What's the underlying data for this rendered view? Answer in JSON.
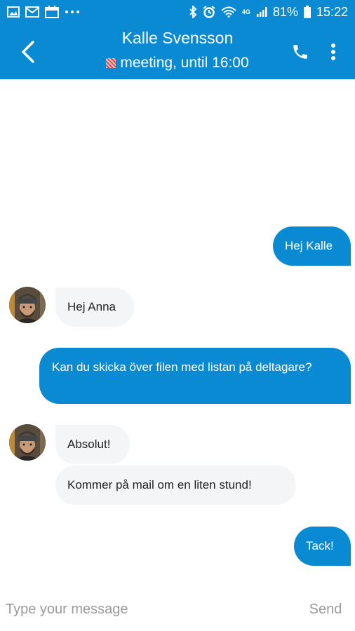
{
  "status_bar": {
    "network": "4G",
    "battery": "81%",
    "time": "15:22",
    "icons_left": [
      "image-icon",
      "mail-icon",
      "calendar-icon",
      "more-dots-icon"
    ],
    "icons_right": [
      "bluetooth-icon",
      "alarm-icon",
      "wifi-icon",
      "signal-icon",
      "battery-icon"
    ]
  },
  "header": {
    "contact_name": "Kalle Svensson",
    "presence": "meeting, until 16:00",
    "presence_color": "#e57373"
  },
  "messages": [
    {
      "direction": "outgoing",
      "text": "Hej Kalle"
    },
    {
      "direction": "incoming",
      "text": "Hej Anna"
    },
    {
      "direction": "outgoing",
      "text": "Kan du skicka över filen med listan på deltagare?"
    },
    {
      "direction": "incoming",
      "text": "Absolut!"
    },
    {
      "direction": "incoming",
      "text": "Kommer på mail om en liten stund!"
    },
    {
      "direction": "outgoing",
      "text": "Tack!"
    }
  ],
  "composer": {
    "placeholder": "Type your message",
    "send_label": "Send"
  },
  "colors": {
    "accent": "#0a8ad3",
    "incoming_bubble": "#f3f5f6"
  }
}
